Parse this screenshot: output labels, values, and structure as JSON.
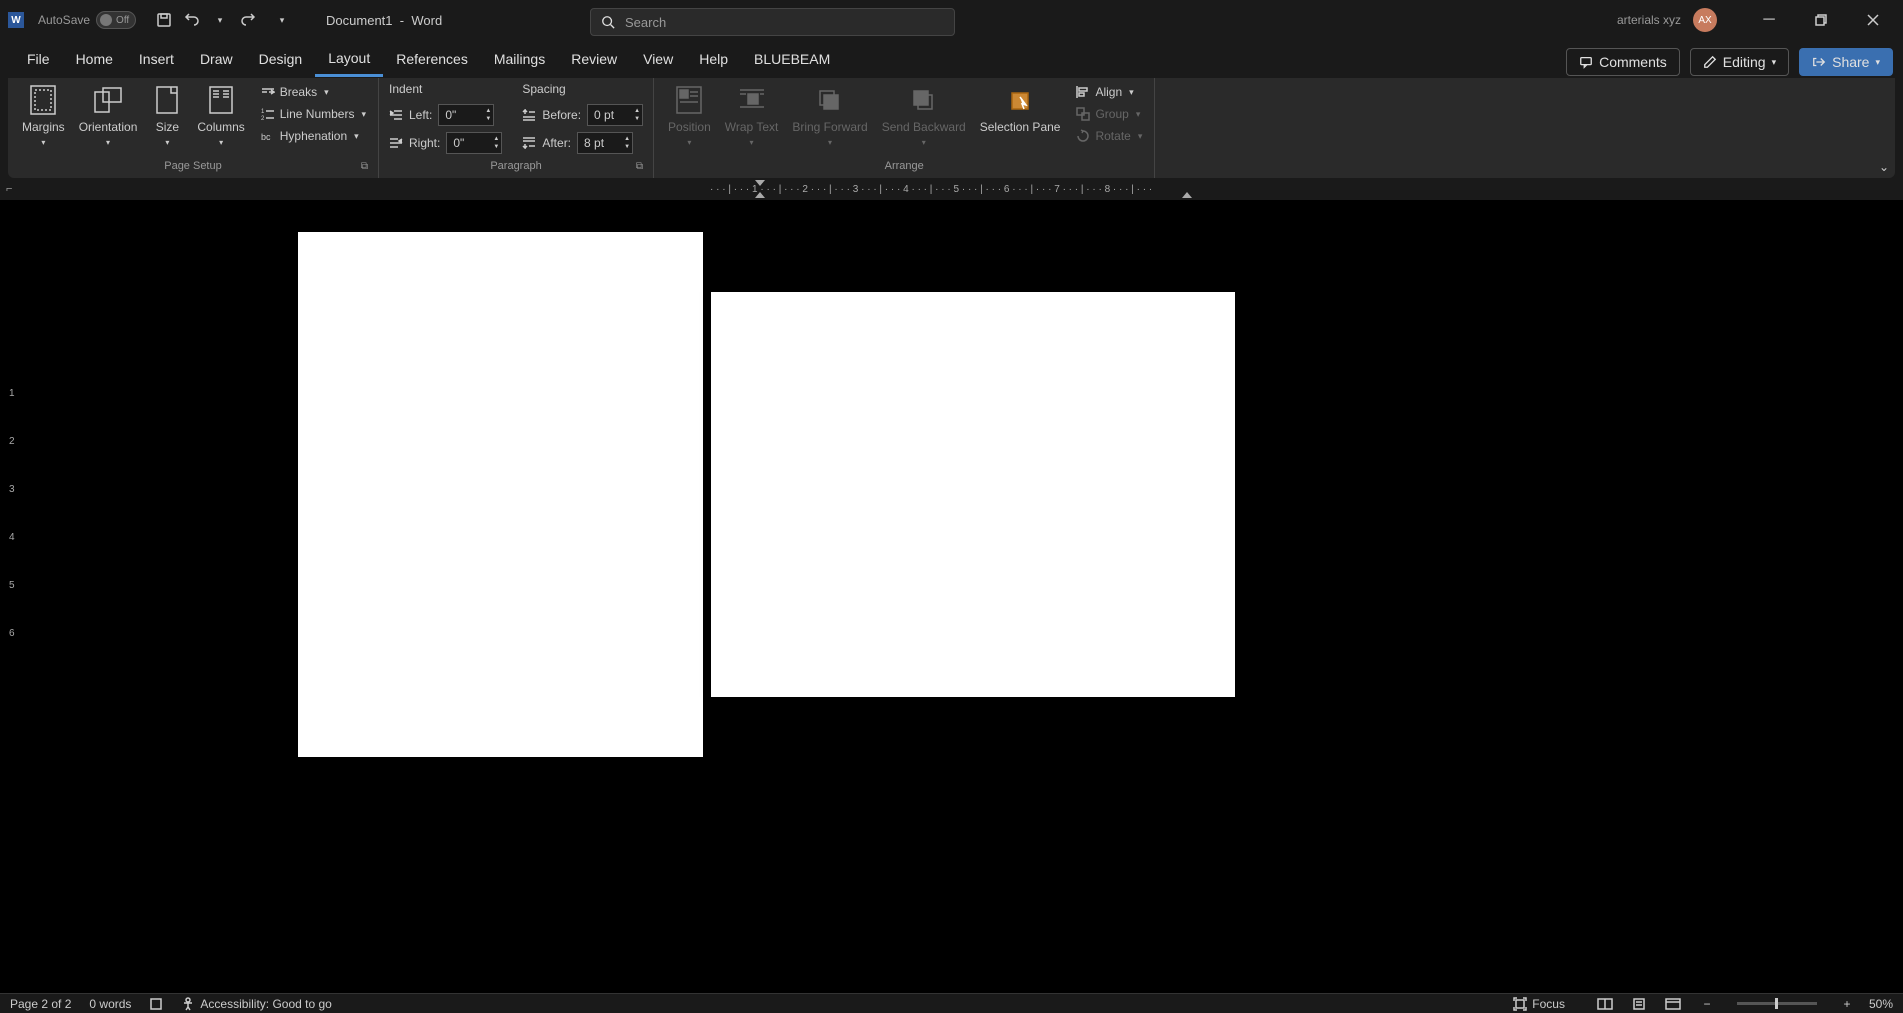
{
  "app": {
    "letter": "W",
    "autosave_label": "AutoSave",
    "autosave_state": "Off",
    "doc_name": "Document1",
    "doc_sep": "-",
    "app_name": "Word"
  },
  "search": {
    "placeholder": "Search"
  },
  "user": {
    "name": "arterials xyz",
    "initials": "AX"
  },
  "tabs": [
    "File",
    "Home",
    "Insert",
    "Draw",
    "Design",
    "Layout",
    "References",
    "Mailings",
    "Review",
    "View",
    "Help",
    "BLUEBEAM"
  ],
  "active_tab": "Layout",
  "actions": {
    "comments": "Comments",
    "editing": "Editing",
    "share": "Share"
  },
  "ribbon": {
    "page_setup": {
      "label": "Page Setup",
      "margins": "Margins",
      "orientation": "Orientation",
      "size": "Size",
      "columns": "Columns",
      "breaks": "Breaks",
      "line_numbers": "Line Numbers",
      "hyphenation": "Hyphenation"
    },
    "paragraph": {
      "label": "Paragraph",
      "indent_label": "Indent",
      "spacing_label": "Spacing",
      "left_label": "Left:",
      "left_val": "0\"",
      "right_label": "Right:",
      "right_val": "0\"",
      "before_label": "Before:",
      "before_val": "0 pt",
      "after_label": "After:",
      "after_val": "8 pt"
    },
    "arrange": {
      "label": "Arrange",
      "position": "Position",
      "wrap": "Wrap Text",
      "bring": "Bring Forward",
      "send": "Send Backward",
      "selection": "Selection Pane",
      "align": "Align",
      "group": "Group",
      "rotate": "Rotate"
    }
  },
  "ruler": {
    "h_marks": "· · · | · · · 1 · · · | · · · 2 · · · | · · · 3 · · · | · · · 4 · · · | · · · 5 · · · | · · · 6 · · · | · · · 7 · · · | · · · 8 · · · | · · ·",
    "v_nums": [
      "1",
      "2",
      "3",
      "4",
      "5",
      "6"
    ]
  },
  "status": {
    "page": "Page 2 of 2",
    "words": "0 words",
    "accessibility": "Accessibility: Good to go",
    "focus": "Focus",
    "zoom": "50%"
  }
}
